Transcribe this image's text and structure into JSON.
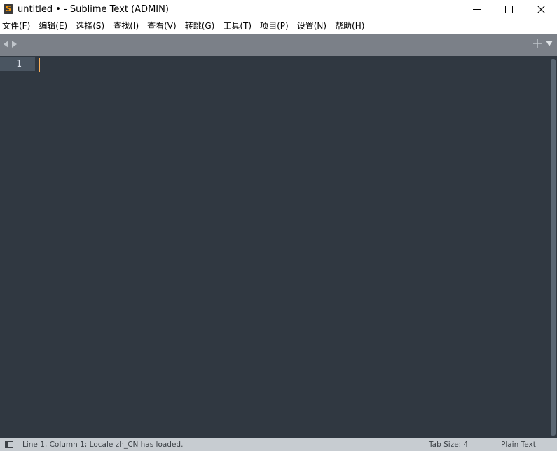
{
  "window": {
    "title": "untitled • - Sublime Text (ADMIN)",
    "app_icon_letter": "S",
    "controls": {
      "minimize_icon": "minimize-icon",
      "maximize_icon": "maximize-icon",
      "close_icon": "close-icon"
    }
  },
  "menu": {
    "items": [
      {
        "label": "文件(F)"
      },
      {
        "label": "编辑(E)"
      },
      {
        "label": "选择(S)"
      },
      {
        "label": "查找(I)"
      },
      {
        "label": "查看(V)"
      },
      {
        "label": "转跳(G)"
      },
      {
        "label": "工具(T)"
      },
      {
        "label": "项目(P)"
      },
      {
        "label": "设置(N)"
      },
      {
        "label": "帮助(H)"
      }
    ]
  },
  "tabbar": {
    "icons": [
      "tab-back-icon",
      "tab-forward-icon",
      "new-tab-plus-icon",
      "tab-list-chevron-icon"
    ]
  },
  "editor": {
    "line_numbers": [
      "1"
    ],
    "content": ""
  },
  "status": {
    "message": "Line 1, Column 1; Locale zh_CN has loaded.",
    "tab_size": "Tab Size: 4",
    "syntax": "Plain Text"
  },
  "colors": {
    "editor_bg": "#303841",
    "gutter_highlight": "#4a5561",
    "cursor": "#f9ae58",
    "tabbar_bg": "#7b8088",
    "statusbar_bg": "#c7ccd1",
    "app_icon_accent": "#ff9800"
  }
}
